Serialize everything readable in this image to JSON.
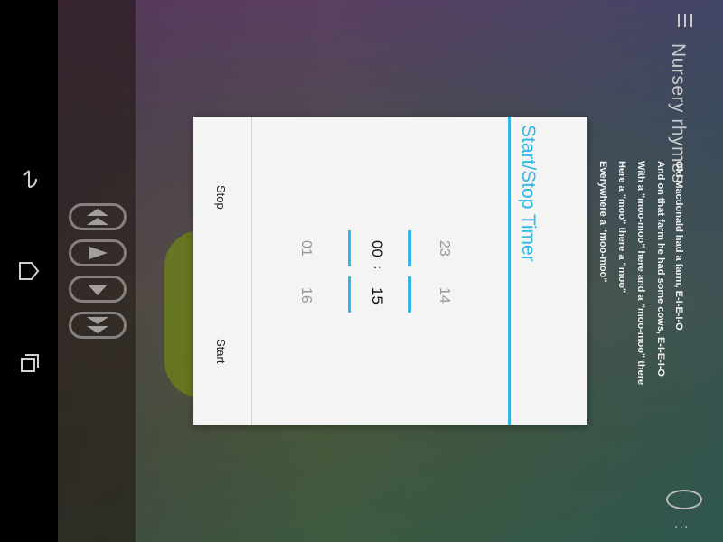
{
  "nav": {
    "back_icon": "back-icon",
    "home_icon": "home-icon",
    "recents_icon": "recents-icon"
  },
  "media": {
    "buttons": [
      "skip-previous-icon",
      "play-icon",
      "down-icon",
      "skip-next-icon"
    ]
  },
  "app": {
    "title": "Nursery rhymes"
  },
  "lyrics": [
    "Old Macdonald had a farm, E-I-E-I-O",
    "And on that farm he had some cows, E-I-E-I-O",
    "With a \"moo-moo\" here and a \"moo-moo\" there",
    "Here a \"moo\" there a \"moo\"",
    "Everywhere a \"moo-moo\""
  ],
  "dialog": {
    "title": "Start/Stop Timer",
    "hours": {
      "prev": "23",
      "current": "00",
      "next": "01"
    },
    "separator": ":",
    "minutes": {
      "prev": "14",
      "current": "15",
      "next": "16"
    },
    "buttons": {
      "stop": "Stop",
      "start": "Start"
    }
  },
  "colors": {
    "accent": "#33b5e5"
  }
}
